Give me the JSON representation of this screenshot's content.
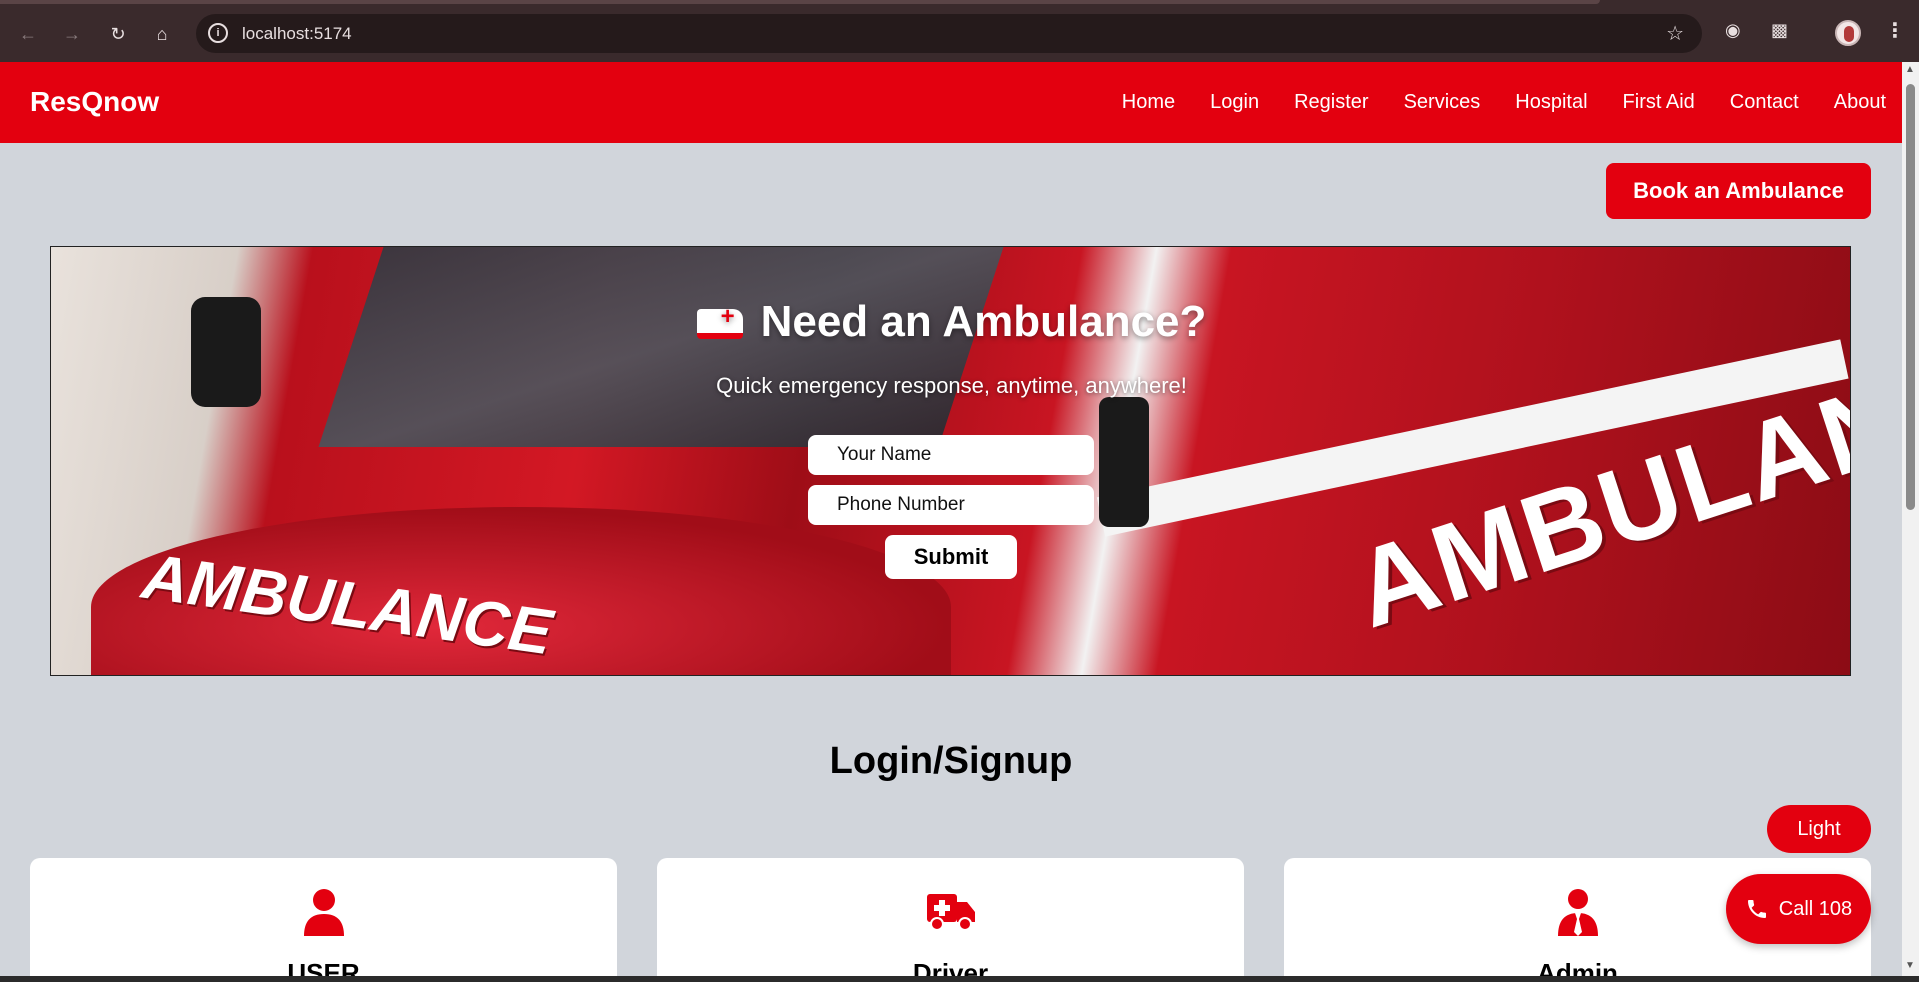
{
  "browser": {
    "url": "localhost:5174"
  },
  "navbar": {
    "brand": "ResQnow",
    "links": [
      "Home",
      "Login",
      "Register",
      "Services",
      "Hospital",
      "First Aid",
      "Contact",
      "About"
    ]
  },
  "actions": {
    "book_label": "Book an Ambulance"
  },
  "hero": {
    "title": "Need an Ambulance?",
    "subtitle": "Quick emergency response, anytime, anywhere!",
    "name_placeholder": "Your Name",
    "phone_placeholder": "Phone Number",
    "submit_label": "Submit",
    "image_text_side": "AMBULANCE",
    "image_text_hood": "AMBULANCE"
  },
  "login_section": {
    "title": "Login/Signup",
    "cards": [
      {
        "label": "USER",
        "icon": "user-icon"
      },
      {
        "label": "Driver",
        "icon": "ambulance-icon"
      },
      {
        "label": "Admin",
        "icon": "admin-icon"
      }
    ]
  },
  "floating": {
    "theme_label": "Light",
    "call_label": "Call 108"
  },
  "colors": {
    "brand_red": "#e3000f",
    "page_bg": "#d1d5db"
  }
}
